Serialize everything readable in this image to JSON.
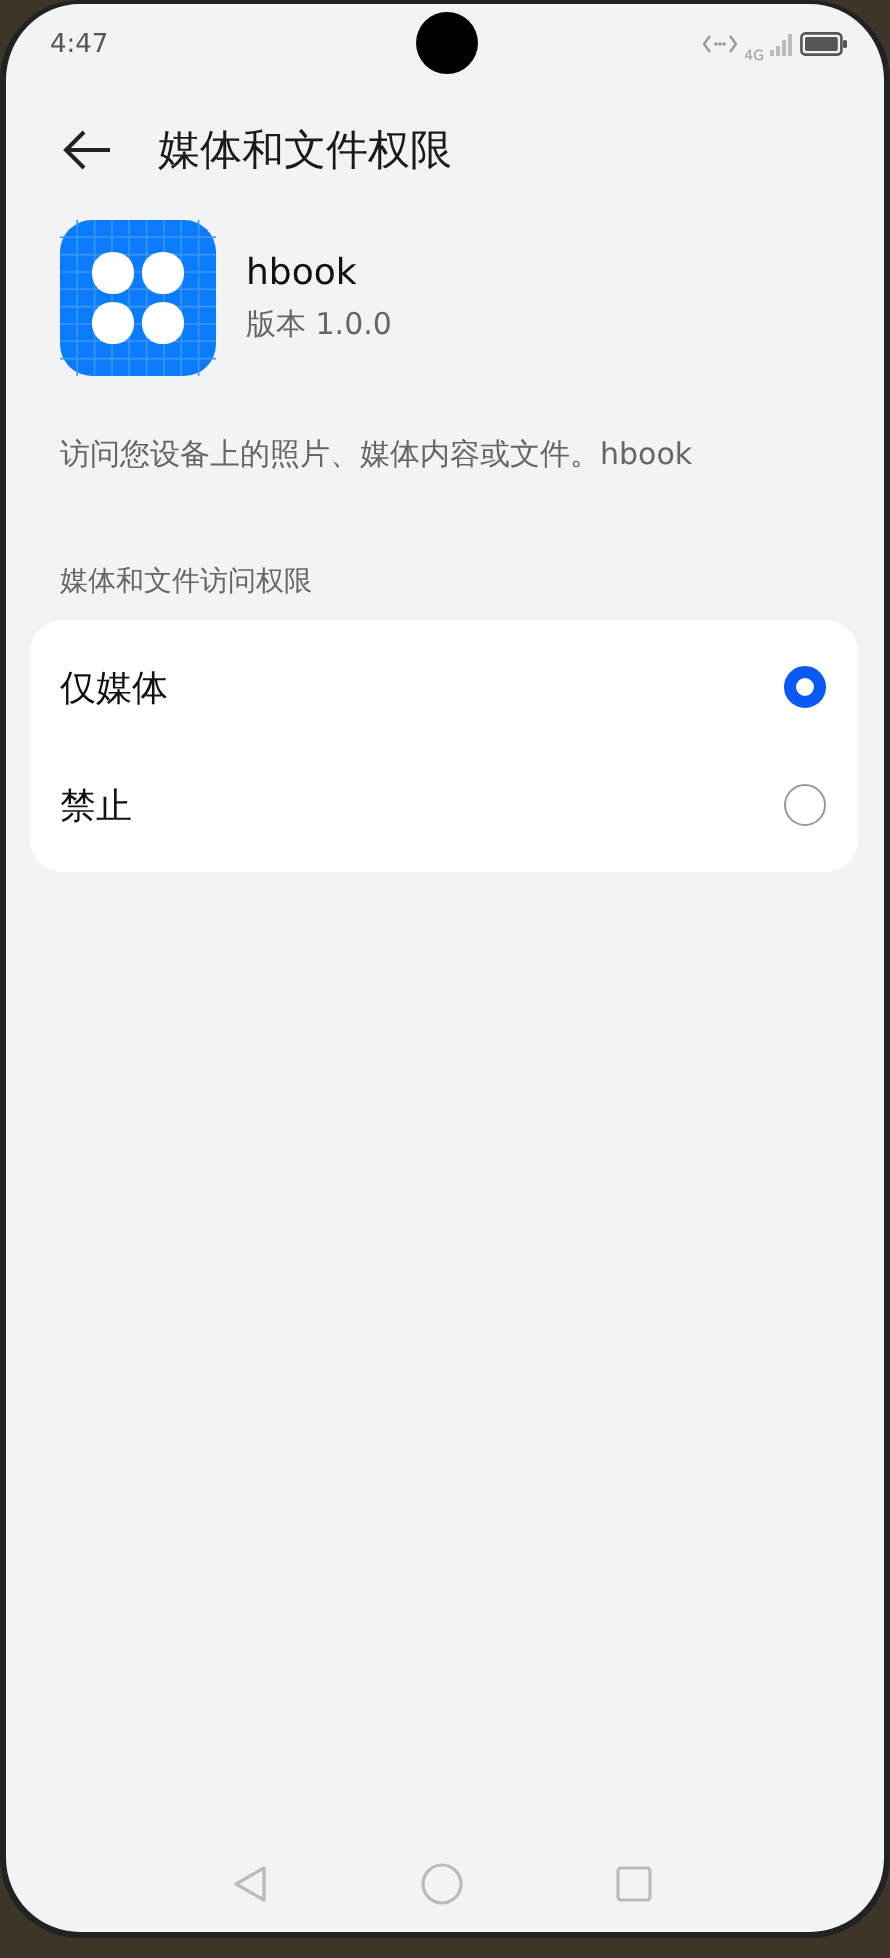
{
  "status_bar": {
    "time": "4:47",
    "network": "4G"
  },
  "header": {
    "title": "媒体和文件权限"
  },
  "app": {
    "name": "hbook",
    "version": "版本 1.0.0"
  },
  "description": "访问您设备上的照片、媒体内容或文件。hbook",
  "section": {
    "title": "媒体和文件访问权限",
    "options": [
      {
        "label": "仅媒体",
        "selected": true
      },
      {
        "label": "禁止",
        "selected": false
      }
    ]
  }
}
